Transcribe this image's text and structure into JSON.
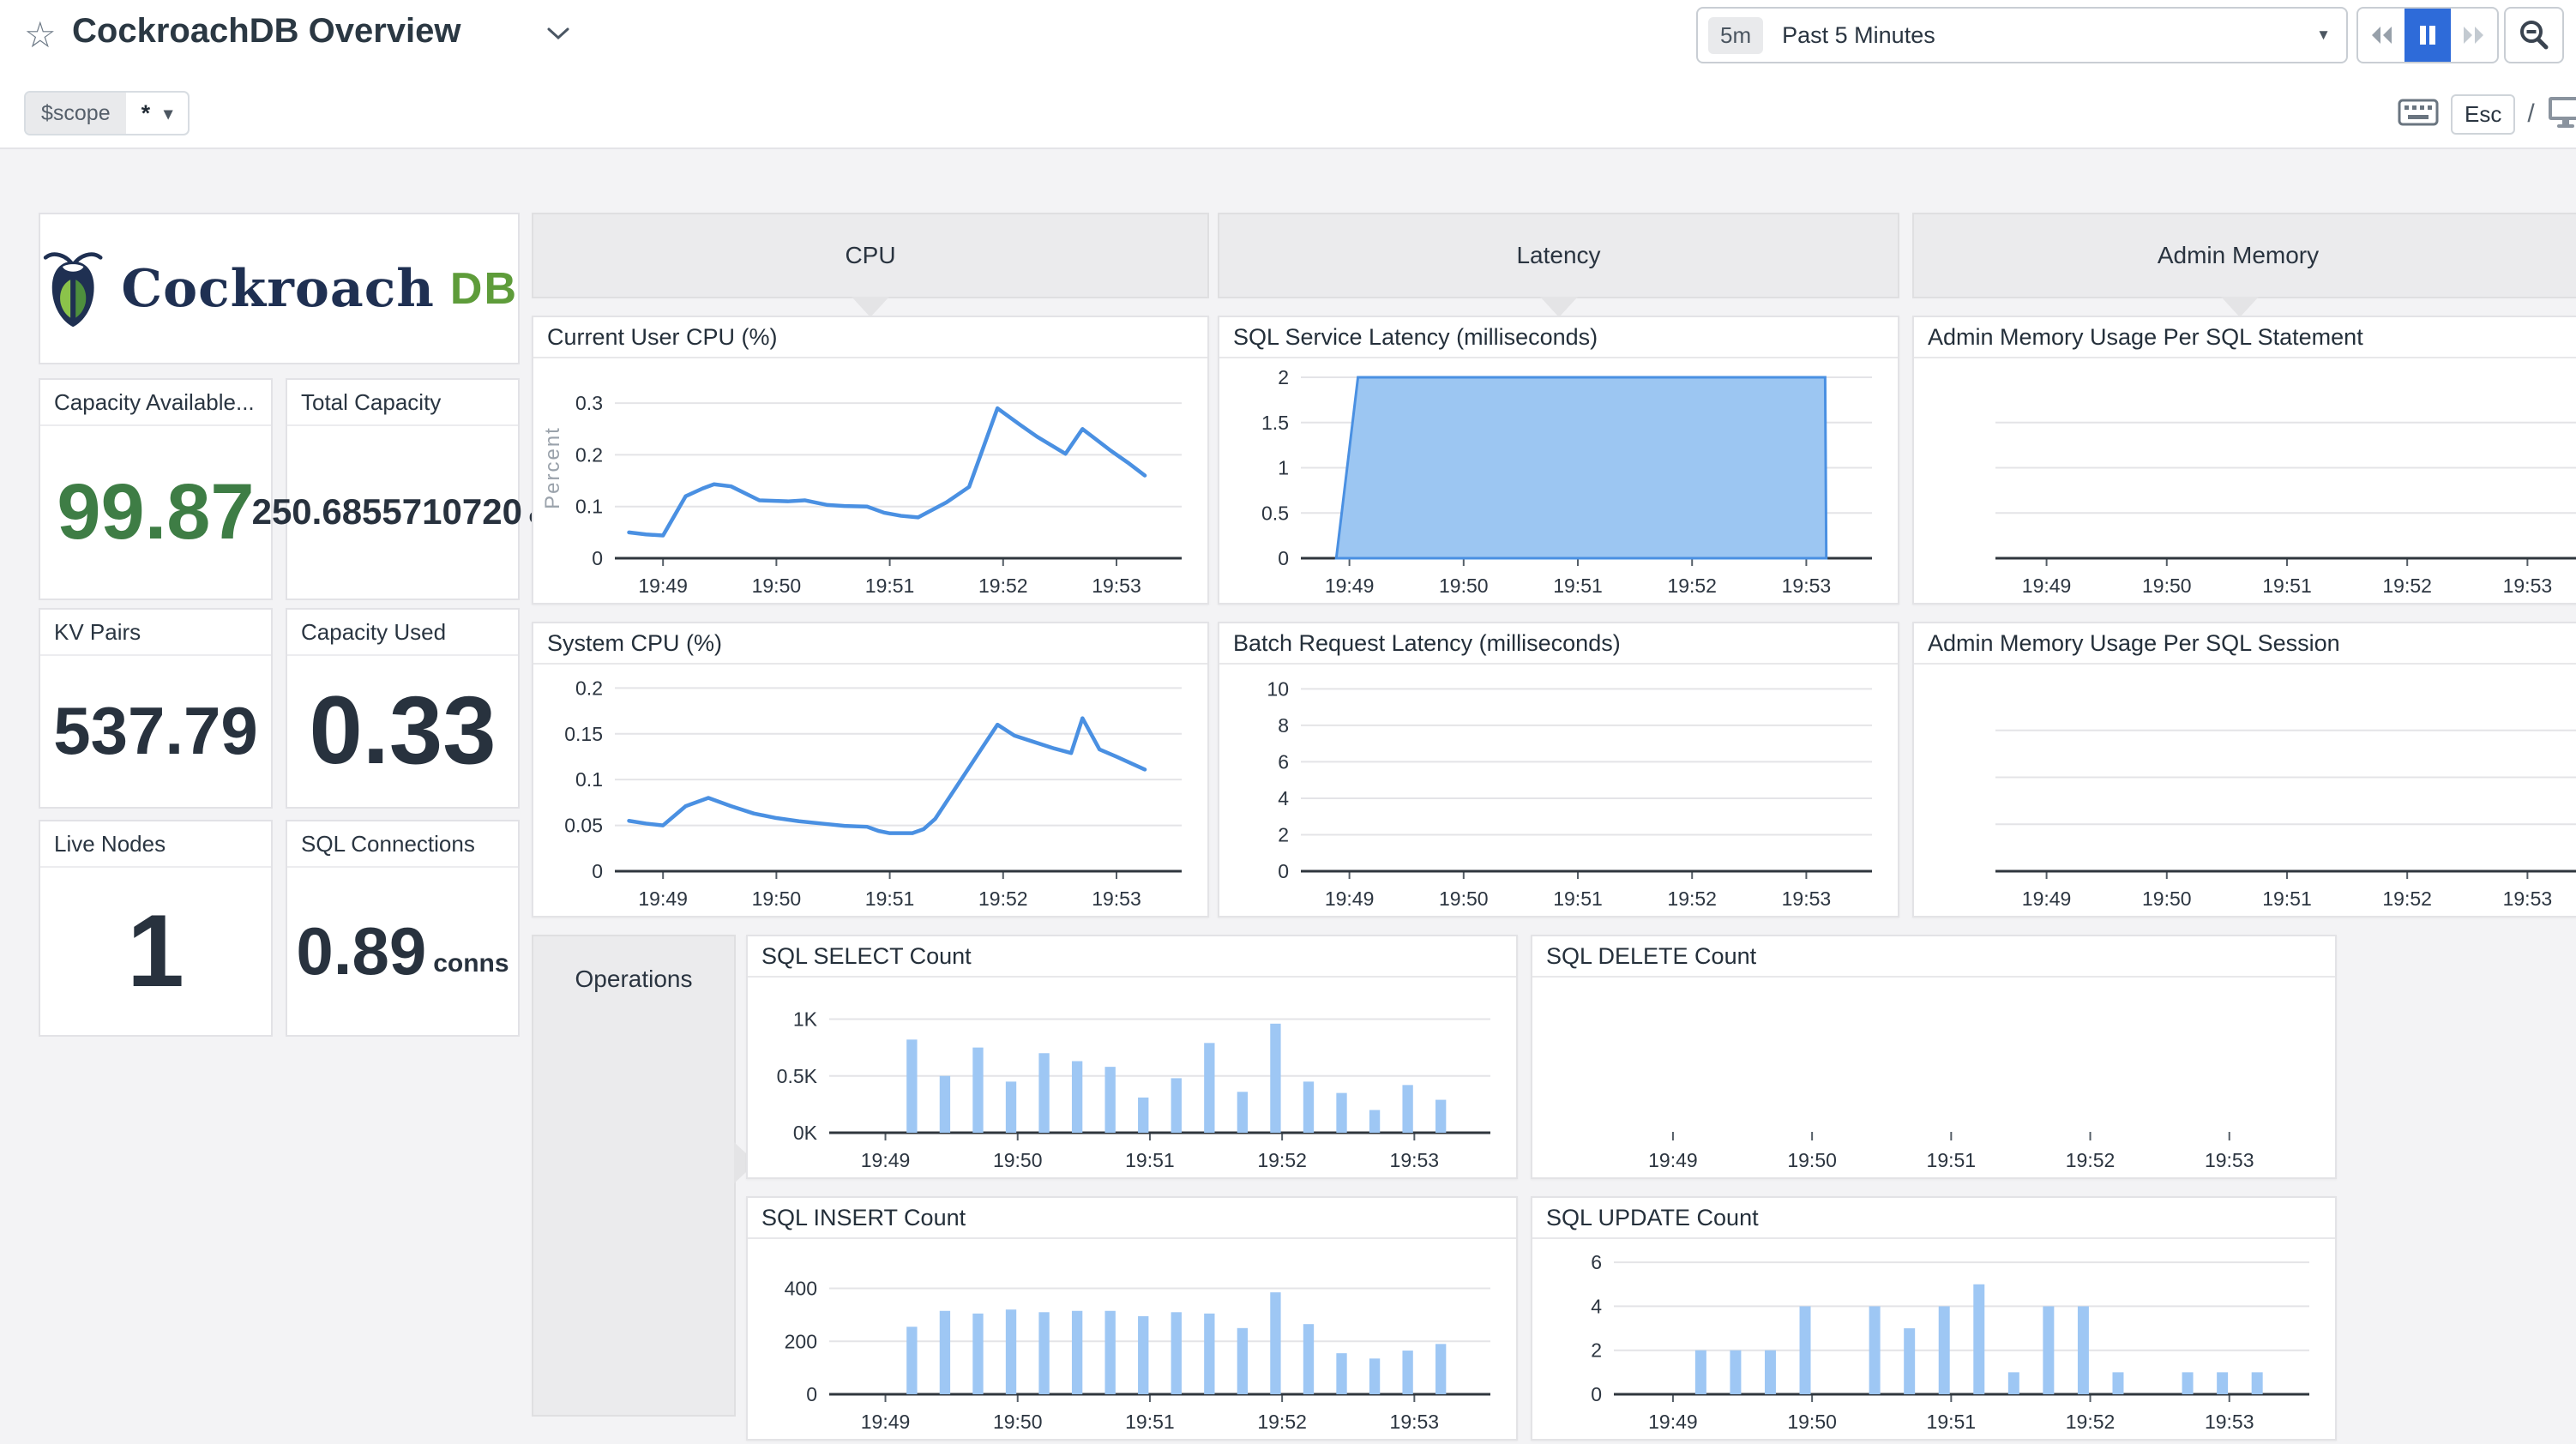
{
  "header": {
    "title": "CockroachDB Overview",
    "scope_label": "$scope",
    "scope_value": "*",
    "time_range_badge": "5m",
    "time_range_label": "Past 5 Minutes",
    "esc_label": "Esc",
    "slash": "/"
  },
  "icons": {
    "star": "star-icon",
    "title_chevron": "chevron-down-icon",
    "time_caret": "caret-down-icon",
    "rewind": "rewind-icon",
    "pause": "pause-icon",
    "forward": "fast-forward-icon",
    "zoom_out": "zoom-out-icon",
    "keyboard": "keyboard-icon",
    "tv_mode": "monitor-icon",
    "logo_bug": "cockroach-bug-icon"
  },
  "logo": {
    "brand": "Cockroach",
    "brand_suffix": "DB"
  },
  "stats": [
    {
      "title": "Capacity Available...",
      "value": "99.87",
      "unit": ""
    },
    {
      "title": "Total Capacity",
      "value": "250.6855710720",
      "unit": "GB"
    },
    {
      "title": "KV Pairs",
      "value": "537.79",
      "unit": ""
    },
    {
      "title": "Capacity Used",
      "value": "0.33",
      "unit": ""
    },
    {
      "title": "Live Nodes",
      "value": "1",
      "unit": ""
    },
    {
      "title": "SQL Connections",
      "value": "0.89",
      "unit": "conns"
    }
  ],
  "groups": {
    "cpu": "CPU",
    "latency": "Latency",
    "admin_memory": "Admin Memory",
    "operations": "Operations"
  },
  "panels": {
    "current_user_cpu": "Current User CPU (%)",
    "system_cpu": "System CPU (%)",
    "sql_service_latency": "SQL Service Latency (milliseconds)",
    "batch_request_latency": "Batch Request Latency (milliseconds)",
    "admin_mem_statement": "Admin Memory Usage Per SQL Statement",
    "admin_mem_session": "Admin Memory Usage Per SQL Session",
    "sql_select": "SQL SELECT Count",
    "sql_delete": "SQL DELETE Count",
    "sql_insert": "SQL INSERT Count",
    "sql_update": "SQL UPDATE Count"
  },
  "colors": {
    "line_blue": "#4a90e2",
    "area_fill": "#9cc6f2",
    "bar_blue": "#9ec7f4",
    "stat_green": "#3e7d45",
    "stat_dark": "#28323e",
    "logo_navy": "#1f3052",
    "logo_green": "#5e9c3a",
    "pause_blue": "#2e6bd9",
    "group_gray": "#ebebed"
  },
  "chart_data": {
    "current_user_cpu": {
      "type": "line",
      "title": "Current User CPU (%)",
      "ylabel": "Percent",
      "color": "#4a90e2",
      "ylim": [
        0,
        0.35
      ],
      "axis": true,
      "yticks": [
        {
          "v": 0,
          "label": "0"
        },
        {
          "v": 0.1,
          "label": "0.1"
        },
        {
          "v": 0.2,
          "label": "0.2"
        },
        {
          "v": 0.3,
          "label": "0.3"
        }
      ],
      "xticks": [
        {
          "p": 0.085,
          "label": "19:49"
        },
        {
          "p": 0.285,
          "label": "19:50"
        },
        {
          "p": 0.485,
          "label": "19:51"
        },
        {
          "p": 0.685,
          "label": "19:52"
        },
        {
          "p": 0.885,
          "label": "19:53"
        }
      ],
      "points": [
        [
          0.025,
          0.05
        ],
        [
          0.055,
          0.046
        ],
        [
          0.085,
          0.044
        ],
        [
          0.125,
          0.12
        ],
        [
          0.155,
          0.135
        ],
        [
          0.175,
          0.143
        ],
        [
          0.205,
          0.139
        ],
        [
          0.255,
          0.112
        ],
        [
          0.305,
          0.11
        ],
        [
          0.335,
          0.112
        ],
        [
          0.375,
          0.103
        ],
        [
          0.405,
          0.101
        ],
        [
          0.445,
          0.1
        ],
        [
          0.475,
          0.088
        ],
        [
          0.505,
          0.082
        ],
        [
          0.535,
          0.079
        ],
        [
          0.585,
          0.108
        ],
        [
          0.625,
          0.138
        ],
        [
          0.675,
          0.29
        ],
        [
          0.715,
          0.258
        ],
        [
          0.745,
          0.235
        ],
        [
          0.795,
          0.202
        ],
        [
          0.825,
          0.25
        ],
        [
          0.875,
          0.208
        ],
        [
          0.905,
          0.185
        ],
        [
          0.935,
          0.16
        ]
      ]
    },
    "system_cpu": {
      "type": "line",
      "title": "System CPU (%)",
      "color": "#4a90e2",
      "ylim": [
        0,
        0.205
      ],
      "axis": true,
      "yticks": [
        {
          "v": 0,
          "label": "0"
        },
        {
          "v": 0.05,
          "label": "0.05"
        },
        {
          "v": 0.1,
          "label": "0.1"
        },
        {
          "v": 0.15,
          "label": "0.15"
        },
        {
          "v": 0.2,
          "label": "0.2"
        }
      ],
      "xticks": [
        {
          "p": 0.085,
          "label": "19:49"
        },
        {
          "p": 0.285,
          "label": "19:50"
        },
        {
          "p": 0.485,
          "label": "19:51"
        },
        {
          "p": 0.685,
          "label": "19:52"
        },
        {
          "p": 0.885,
          "label": "19:53"
        }
      ],
      "points": [
        [
          0.025,
          0.055
        ],
        [
          0.055,
          0.052
        ],
        [
          0.085,
          0.05
        ],
        [
          0.125,
          0.071
        ],
        [
          0.165,
          0.08
        ],
        [
          0.205,
          0.071
        ],
        [
          0.245,
          0.063
        ],
        [
          0.285,
          0.058
        ],
        [
          0.325,
          0.0545
        ],
        [
          0.365,
          0.052
        ],
        [
          0.405,
          0.0495
        ],
        [
          0.445,
          0.0485
        ],
        [
          0.465,
          0.044
        ],
        [
          0.485,
          0.0415
        ],
        [
          0.525,
          0.0415
        ],
        [
          0.545,
          0.046
        ],
        [
          0.565,
          0.057
        ],
        [
          0.675,
          0.16
        ],
        [
          0.705,
          0.148
        ],
        [
          0.735,
          0.142
        ],
        [
          0.775,
          0.134
        ],
        [
          0.805,
          0.129
        ],
        [
          0.825,
          0.167
        ],
        [
          0.855,
          0.133
        ],
        [
          0.885,
          0.125
        ],
        [
          0.935,
          0.111
        ]
      ]
    },
    "sql_service_latency": {
      "type": "area",
      "title": "SQL Service Latency (milliseconds)",
      "color": "#4a90e2",
      "fill": "#9cc6f2",
      "ylim": [
        0,
        2
      ],
      "axis": true,
      "yticks": [
        {
          "v": 0,
          "label": "0"
        },
        {
          "v": 0.5,
          "label": "0.5"
        },
        {
          "v": 1,
          "label": "1"
        },
        {
          "v": 1.5,
          "label": "1.5"
        },
        {
          "v": 2,
          "label": "2"
        }
      ],
      "xticks": [
        {
          "p": 0.085,
          "label": "19:49"
        },
        {
          "p": 0.285,
          "label": "19:50"
        },
        {
          "p": 0.485,
          "label": "19:51"
        },
        {
          "p": 0.685,
          "label": "19:52"
        },
        {
          "p": 0.885,
          "label": "19:53"
        }
      ],
      "points": [
        [
          0.062,
          0
        ],
        [
          0.1,
          2
        ],
        [
          0.918,
          2
        ],
        [
          0.92,
          0
        ]
      ]
    },
    "batch_request_latency": {
      "type": "empty",
      "title": "Batch Request Latency (milliseconds)",
      "ylim": [
        0,
        10.3
      ],
      "axis": true,
      "yticks": [
        {
          "v": 0,
          "label": "0"
        },
        {
          "v": 2,
          "label": "2"
        },
        {
          "v": 4,
          "label": "4"
        },
        {
          "v": 6,
          "label": "6"
        },
        {
          "v": 8,
          "label": "8"
        },
        {
          "v": 10,
          "label": "10"
        }
      ],
      "xticks": [
        {
          "p": 0.085,
          "label": "19:49"
        },
        {
          "p": 0.285,
          "label": "19:50"
        },
        {
          "p": 0.485,
          "label": "19:51"
        },
        {
          "p": 0.685,
          "label": "19:52"
        },
        {
          "p": 0.885,
          "label": "19:53"
        }
      ]
    },
    "admin_mem_statement": {
      "type": "empty",
      "title": "Admin Memory Usage Per SQL Statement",
      "ylim": [
        0,
        4
      ],
      "axis": true,
      "yticks": [
        {
          "v": 1
        },
        {
          "v": 2
        },
        {
          "v": 3
        }
      ],
      "xticks": [
        {
          "p": 0.085,
          "label": "19:49"
        },
        {
          "p": 0.285,
          "label": "19:50"
        },
        {
          "p": 0.485,
          "label": "19:51"
        },
        {
          "p": 0.685,
          "label": "19:52"
        },
        {
          "p": 0.885,
          "label": "19:53"
        }
      ]
    },
    "admin_mem_session": {
      "type": "empty",
      "title": "Admin Memory Usage Per SQL Session",
      "ylim": [
        0,
        4
      ],
      "axis": true,
      "yticks": [
        {
          "v": 1
        },
        {
          "v": 2
        },
        {
          "v": 3
        }
      ],
      "xticks": [
        {
          "p": 0.085,
          "label": "19:49"
        },
        {
          "p": 0.285,
          "label": "19:50"
        },
        {
          "p": 0.485,
          "label": "19:51"
        },
        {
          "p": 0.685,
          "label": "19:52"
        },
        {
          "p": 0.885,
          "label": "19:53"
        }
      ]
    },
    "sql_select": {
      "type": "bar",
      "title": "SQL SELECT Count",
      "barcolor": "#9ec7f4",
      "ylim": [
        0,
        1.2
      ],
      "axis": true,
      "barw": 0.016,
      "yticks": [
        {
          "v": 0,
          "label": "0K"
        },
        {
          "v": 0.5,
          "label": "0.5K"
        },
        {
          "v": 1,
          "label": "1K"
        }
      ],
      "xticks": [
        {
          "p": 0.085,
          "label": "19:49"
        },
        {
          "p": 0.285,
          "label": "19:50"
        },
        {
          "p": 0.485,
          "label": "19:51"
        },
        {
          "p": 0.685,
          "label": "19:52"
        },
        {
          "p": 0.885,
          "label": "19:53"
        }
      ],
      "bars": [
        {
          "p": 0.125,
          "v": 0.82
        },
        {
          "p": 0.175,
          "v": 0.5
        },
        {
          "p": 0.225,
          "v": 0.75
        },
        {
          "p": 0.275,
          "v": 0.45
        },
        {
          "p": 0.325,
          "v": 0.7
        },
        {
          "p": 0.375,
          "v": 0.63
        },
        {
          "p": 0.425,
          "v": 0.58
        },
        {
          "p": 0.475,
          "v": 0.31
        },
        {
          "p": 0.525,
          "v": 0.48
        },
        {
          "p": 0.575,
          "v": 0.79
        },
        {
          "p": 0.625,
          "v": 0.36
        },
        {
          "p": 0.675,
          "v": 0.96
        },
        {
          "p": 0.725,
          "v": 0.45
        },
        {
          "p": 0.775,
          "v": 0.35
        },
        {
          "p": 0.825,
          "v": 0.2
        },
        {
          "p": 0.875,
          "v": 0.42
        },
        {
          "p": 0.925,
          "v": 0.29
        }
      ]
    },
    "sql_delete": {
      "type": "empty",
      "title": "SQL DELETE Count",
      "ylim": [
        0,
        1
      ],
      "axis": false,
      "yticks": [],
      "xticks": [
        {
          "p": 0.085,
          "label": "19:49"
        },
        {
          "p": 0.285,
          "label": "19:50"
        },
        {
          "p": 0.485,
          "label": "19:51"
        },
        {
          "p": 0.685,
          "label": "19:52"
        },
        {
          "p": 0.885,
          "label": "19:53"
        }
      ]
    },
    "sql_insert": {
      "type": "bar",
      "title": "SQL INSERT Count",
      "barcolor": "#9ec7f4",
      "ylim": [
        0,
        515
      ],
      "axis": true,
      "barw": 0.016,
      "yticks": [
        {
          "v": 0,
          "label": "0"
        },
        {
          "v": 200,
          "label": "200"
        },
        {
          "v": 400,
          "label": "400"
        }
      ],
      "xticks": [
        {
          "p": 0.085,
          "label": "19:49"
        },
        {
          "p": 0.285,
          "label": "19:50"
        },
        {
          "p": 0.485,
          "label": "19:51"
        },
        {
          "p": 0.685,
          "label": "19:52"
        },
        {
          "p": 0.885,
          "label": "19:53"
        }
      ],
      "bars": [
        {
          "p": 0.125,
          "v": 255
        },
        {
          "p": 0.175,
          "v": 315
        },
        {
          "p": 0.225,
          "v": 305
        },
        {
          "p": 0.275,
          "v": 320
        },
        {
          "p": 0.325,
          "v": 310
        },
        {
          "p": 0.375,
          "v": 315
        },
        {
          "p": 0.425,
          "v": 315
        },
        {
          "p": 0.475,
          "v": 295
        },
        {
          "p": 0.525,
          "v": 310
        },
        {
          "p": 0.575,
          "v": 305
        },
        {
          "p": 0.625,
          "v": 250
        },
        {
          "p": 0.675,
          "v": 385
        },
        {
          "p": 0.725,
          "v": 265
        },
        {
          "p": 0.775,
          "v": 155
        },
        {
          "p": 0.825,
          "v": 135
        },
        {
          "p": 0.875,
          "v": 165
        },
        {
          "p": 0.925,
          "v": 190
        }
      ]
    },
    "sql_update": {
      "type": "bar",
      "title": "SQL UPDATE Count",
      "barcolor": "#9ec7f4",
      "ylim": [
        0,
        6.2
      ],
      "axis": true,
      "barw": 0.016,
      "yticks": [
        {
          "v": 0,
          "label": "0"
        },
        {
          "v": 2,
          "label": "2"
        },
        {
          "v": 4,
          "label": "4"
        },
        {
          "v": 6,
          "label": "6"
        }
      ],
      "xticks": [
        {
          "p": 0.085,
          "label": "19:49"
        },
        {
          "p": 0.285,
          "label": "19:50"
        },
        {
          "p": 0.485,
          "label": "19:51"
        },
        {
          "p": 0.685,
          "label": "19:52"
        },
        {
          "p": 0.885,
          "label": "19:53"
        }
      ],
      "bars": [
        {
          "p": 0.125,
          "v": 2
        },
        {
          "p": 0.175,
          "v": 2
        },
        {
          "p": 0.225,
          "v": 2
        },
        {
          "p": 0.275,
          "v": 4
        },
        {
          "p": 0.325,
          "v": null
        },
        {
          "p": 0.375,
          "v": 4
        },
        {
          "p": 0.425,
          "v": 3
        },
        {
          "p": 0.475,
          "v": 4
        },
        {
          "p": 0.525,
          "v": 5
        },
        {
          "p": 0.575,
          "v": 1
        },
        {
          "p": 0.625,
          "v": 4
        },
        {
          "p": 0.675,
          "v": 4
        },
        {
          "p": 0.725,
          "v": 1
        },
        {
          "p": 0.775,
          "v": null
        },
        {
          "p": 0.825,
          "v": 1
        },
        {
          "p": 0.875,
          "v": 1
        },
        {
          "p": 0.925,
          "v": 1
        }
      ]
    }
  }
}
